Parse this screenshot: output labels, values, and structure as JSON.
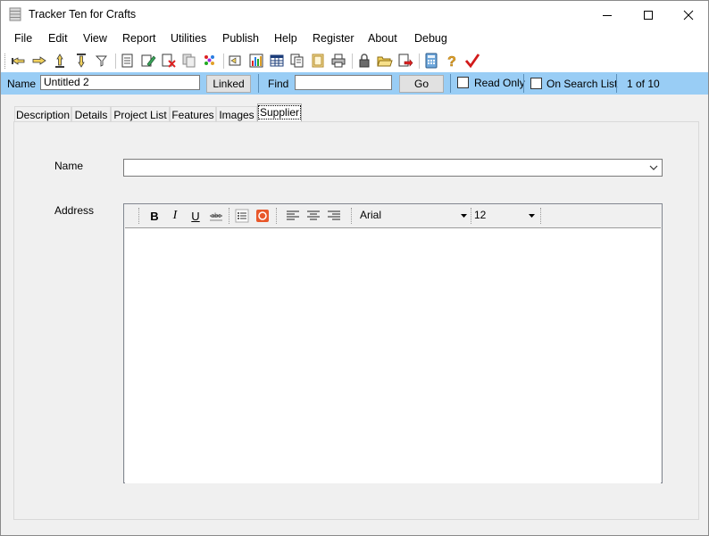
{
  "window": {
    "title": "Tracker Ten for Crafts",
    "controls": [
      "minimize-icon",
      "maximize-icon",
      "close-icon"
    ]
  },
  "menu": {
    "items": [
      "File",
      "Edit",
      "View",
      "Report",
      "Utilities",
      "Publish",
      "Help",
      "Register",
      "About",
      "Debug"
    ]
  },
  "toolbar": {
    "icons": [
      "first-record-icon",
      "previous-record-icon",
      "next-record-icon",
      "last-record-icon",
      "filter-icon",
      "new-record-icon",
      "edit-record-icon",
      "delete-record-icon",
      "copy-record-icon",
      "find-icon",
      "sort-icon",
      "chart-icon",
      "grid-view-icon",
      "duplicate-icon",
      "image-icon",
      "print-icon",
      "lock-icon",
      "open-folder-icon",
      "export-icon",
      "calculator-icon",
      "help-icon",
      "checkmark-icon"
    ]
  },
  "searchbar": {
    "name_label": "Name",
    "name_value": "Untitled 2",
    "linked_label": "Linked",
    "find_label": "Find",
    "find_value": "",
    "go_label": "Go",
    "read_only_label": "Read Only",
    "read_only_checked": false,
    "on_search_list_label": "On Search List",
    "on_search_list_checked": false,
    "record_position": "1 of 10"
  },
  "tabs": [
    {
      "label": "Description",
      "active": false
    },
    {
      "label": "Details",
      "active": false
    },
    {
      "label": "Project List",
      "active": false
    },
    {
      "label": "Features",
      "active": false
    },
    {
      "label": "Images",
      "active": false
    },
    {
      "label": "Supplier",
      "active": true
    }
  ],
  "supplier": {
    "name_label": "Name",
    "name_value": "",
    "address_label": "Address",
    "address_value": "",
    "editor": {
      "bold": "B",
      "italic": "I",
      "underline": "U",
      "font": "Arial",
      "size": "12"
    }
  }
}
